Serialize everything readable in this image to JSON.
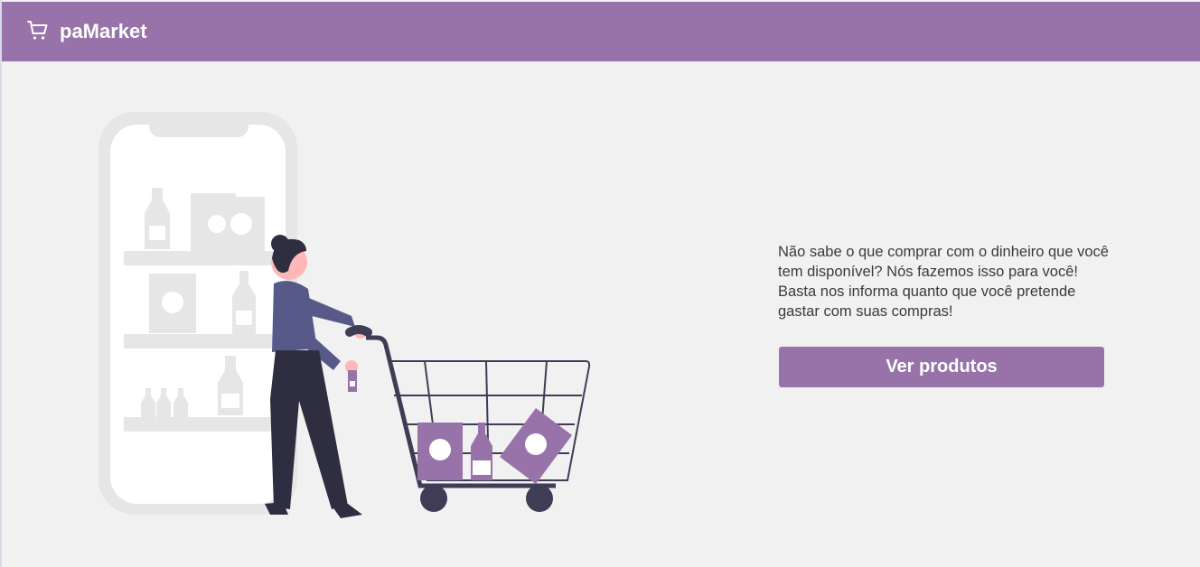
{
  "header": {
    "brand": "paMarket",
    "icon": "cart-icon",
    "color": "#9773aa"
  },
  "main": {
    "illustration": "shopping-illustration",
    "description": "Não sabe o que comprar com o dinheiro que você tem disponível? Nós fazemos isso para você! Basta nos informa quanto que você pretende gastar com suas compras!",
    "button_label": "Ver produtos"
  }
}
